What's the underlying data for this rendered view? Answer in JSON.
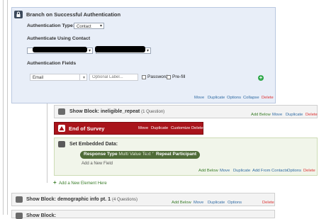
{
  "auth_block": {
    "title": "Branch on Successful Authentication",
    "type_label": "Authentication Type:",
    "type_value": "Contact",
    "contact_label": "Authenticate Using Contact",
    "fields_label": "Authentication Fields",
    "field_value": "Email",
    "label_placeholder": "Optional Label...",
    "password_label": "Password",
    "prefill_label": "Pre-fill",
    "actions": [
      "Move",
      "Duplicate",
      "Options",
      "Collapse",
      "Delete"
    ]
  },
  "show_block_1": {
    "title": "Show Block: ineligible_repeat",
    "count": "(1 Question)",
    "actions": [
      "Add Below",
      "Move",
      "Duplicate",
      "Delete"
    ]
  },
  "end_survey": {
    "title": "End of Survey",
    "actions": [
      "Move",
      "Duplicate",
      "Customize",
      "Delete"
    ]
  },
  "embedded": {
    "title": "Set Embedded Data:",
    "pill1": "Response Type",
    "pill1_value": "Multi Value Text Set",
    "equals": "=",
    "pill2": "Repeat Participant",
    "add_field": "Add a New Field",
    "actions": [
      "Add Below",
      "Move",
      "Duplicate",
      "Add From Contacts",
      "Options",
      "Delete"
    ]
  },
  "add_element": "Add a New Element Here",
  "show_block_2": {
    "title": "Show Block: demographic info pt. 1",
    "count": "(4 Questions)",
    "actions": [
      "Add Below",
      "Move",
      "Duplicate",
      "Options",
      "Delete"
    ]
  },
  "show_block_3": {
    "title": "Show Block:"
  },
  "colors": {
    "end_survey_bg": "#a9141b",
    "embedded_pill": "#4f6b38",
    "add_green": "#2fa84a",
    "link_blue": "#2f6aa3"
  }
}
